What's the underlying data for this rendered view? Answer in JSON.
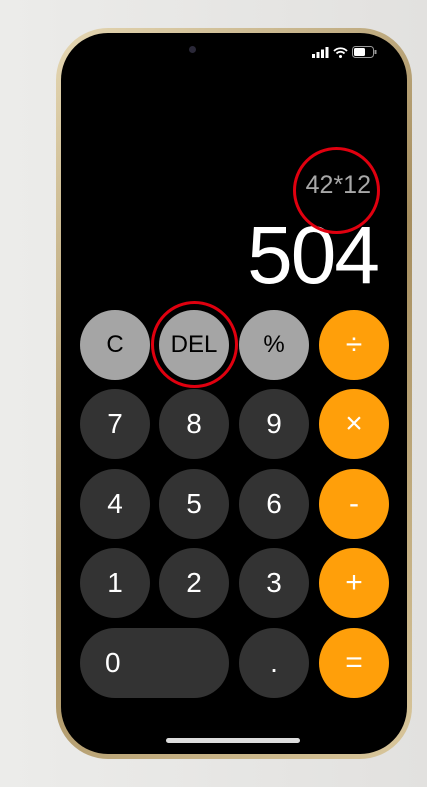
{
  "display": {
    "expression": "42*12",
    "result": "504"
  },
  "keys": [
    {
      "label": "C",
      "type": "fn"
    },
    {
      "label": "DEL",
      "type": "fn"
    },
    {
      "label": "%",
      "type": "fn"
    },
    {
      "label": "÷",
      "type": "op"
    },
    {
      "label": "7",
      "type": "num"
    },
    {
      "label": "8",
      "type": "num"
    },
    {
      "label": "9",
      "type": "num"
    },
    {
      "label": "×",
      "type": "op"
    },
    {
      "label": "4",
      "type": "num"
    },
    {
      "label": "5",
      "type": "num"
    },
    {
      "label": "6",
      "type": "num"
    },
    {
      "label": "-",
      "type": "op"
    },
    {
      "label": "1",
      "type": "num"
    },
    {
      "label": "2",
      "type": "num"
    },
    {
      "label": "3",
      "type": "num"
    },
    {
      "label": "+",
      "type": "op"
    },
    {
      "label": "0",
      "type": "num"
    },
    {
      "label": ".",
      "type": "num"
    },
    {
      "label": "=",
      "type": "op"
    }
  ],
  "status": {
    "icons": [
      "signal-icon",
      "wifi-icon",
      "battery-icon"
    ]
  },
  "colors": {
    "operator": "#ff9f0a",
    "function": "#a5a5a5",
    "number": "#333333",
    "highlight": "#e0000f"
  }
}
